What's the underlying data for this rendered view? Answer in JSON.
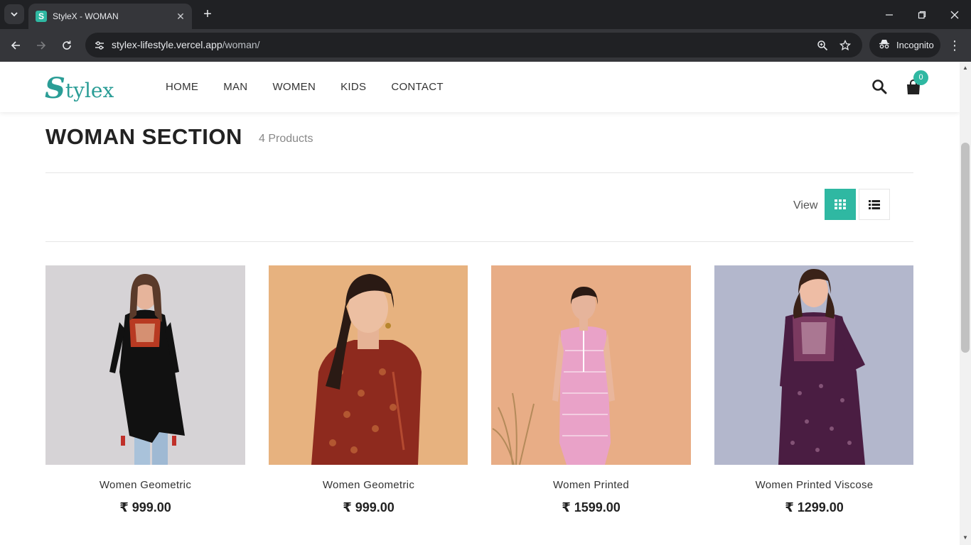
{
  "browser": {
    "tab_title": "StyleX - WOMAN",
    "url_host": "stylex-lifestyle.vercel.app",
    "url_path": "/woman/",
    "incognito_label": "Incognito"
  },
  "site": {
    "logo_initial": "S",
    "logo_rest": "tylex",
    "nav": [
      "HOME",
      "MAN",
      "WOMEN",
      "KIDS",
      "CONTACT"
    ],
    "cart_count": "0",
    "accent_color": "#2fb8a2"
  },
  "section": {
    "title": "WOMAN SECTION",
    "count": "4 Products",
    "view_label": "View"
  },
  "products": [
    {
      "name": "Women Geometric",
      "price": "₹ 999.00"
    },
    {
      "name": "Women Geometric",
      "price": "₹ 999.00"
    },
    {
      "name": "Women Printed",
      "price": "₹ 1599.00"
    },
    {
      "name": "Women Printed Viscose",
      "price": "₹ 1299.00"
    }
  ]
}
